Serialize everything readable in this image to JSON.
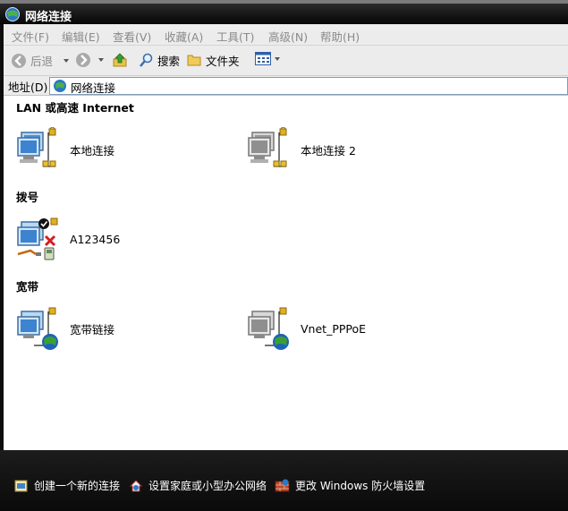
{
  "window": {
    "title": "网络连接"
  },
  "menu": [
    "文件(F)",
    "编辑(E)",
    "查看(V)",
    "收藏(A)",
    "工具(T)",
    "高级(N)",
    "帮助(H)"
  ],
  "toolbar": {
    "back": "后退",
    "search": "搜索",
    "folders": "文件夹"
  },
  "address": {
    "label": "地址(D)",
    "value": "网络连接"
  },
  "groups": {
    "lan": {
      "title": "LAN 或高速 Internet",
      "items": [
        "本地连接",
        "本地连接 2"
      ]
    },
    "dialup": {
      "title": "拨号",
      "items": [
        "A123456"
      ]
    },
    "broadband": {
      "title": "宽带",
      "items": [
        "宽带链接",
        "Vnet_PPPoE"
      ]
    }
  },
  "tasks": [
    "创建一个新的连接",
    "设置家庭或小型办公网络",
    "更改 Windows 防火墙设置"
  ]
}
